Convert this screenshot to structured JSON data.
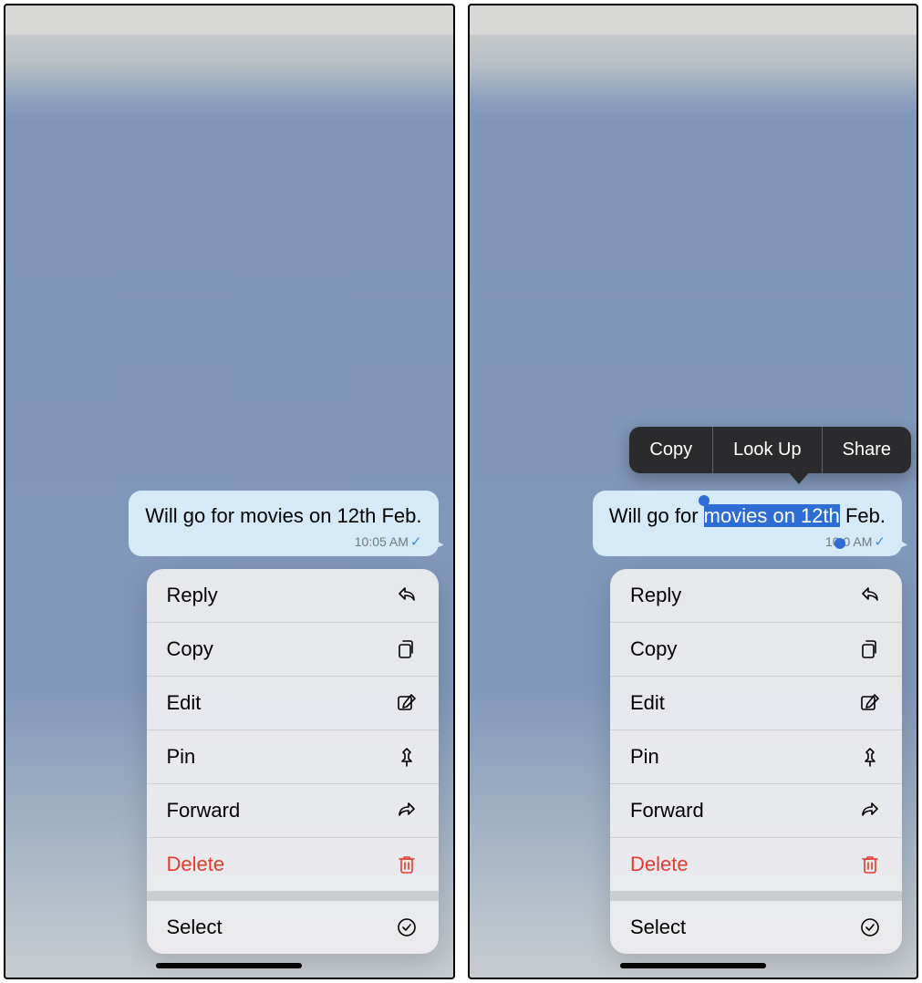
{
  "left": {
    "message": {
      "text": "Will go for movies on 12th Feb.",
      "time": "10:05 AM"
    },
    "menu": {
      "items": [
        {
          "label": "Reply",
          "icon": "reply-icon",
          "destructive": false
        },
        {
          "label": "Copy",
          "icon": "copies-icon",
          "destructive": false
        },
        {
          "label": "Edit",
          "icon": "compose-icon",
          "destructive": false
        },
        {
          "label": "Pin",
          "icon": "pin-icon",
          "destructive": false
        },
        {
          "label": "Forward",
          "icon": "forward-icon",
          "destructive": false
        },
        {
          "label": "Delete",
          "icon": "trash-icon",
          "destructive": true
        }
      ],
      "secondary": {
        "label": "Select",
        "icon": "select-icon"
      }
    }
  },
  "right": {
    "message": {
      "prefix": "Will go for ",
      "selected": "movies on 12th",
      "suffix": " Feb.",
      "time_partial_left": "10:0",
      "time_partial_right": " AM"
    },
    "callout": {
      "items": [
        "Copy",
        "Look Up",
        "Share"
      ]
    },
    "menu": {
      "items": [
        {
          "label": "Reply",
          "icon": "reply-icon",
          "destructive": false
        },
        {
          "label": "Copy",
          "icon": "copies-icon",
          "destructive": false
        },
        {
          "label": "Edit",
          "icon": "compose-icon",
          "destructive": false
        },
        {
          "label": "Pin",
          "icon": "pin-icon",
          "destructive": false
        },
        {
          "label": "Forward",
          "icon": "forward-icon",
          "destructive": false
        },
        {
          "label": "Delete",
          "icon": "trash-icon",
          "destructive": true
        }
      ],
      "secondary": {
        "label": "Select",
        "icon": "select-icon"
      }
    }
  }
}
